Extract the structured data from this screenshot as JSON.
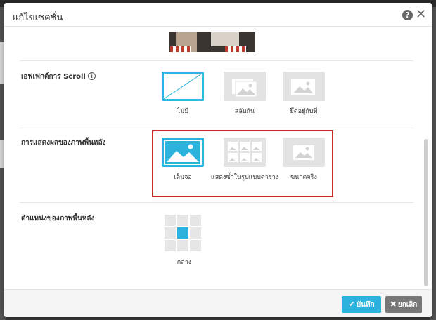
{
  "dialog": {
    "title": "แก้ไขเซคชั่น",
    "help_icon": "question-circle-icon",
    "close_icon": "close-icon"
  },
  "sections": {
    "scroll_effect": {
      "label": "เอฟเฟกต์การ Scroll",
      "info_icon": "info-icon",
      "options": [
        {
          "label": "ไม่มี",
          "selected": true
        },
        {
          "label": "สลับกัน",
          "selected": false
        },
        {
          "label": "ยึดอยู่กับที่",
          "selected": false
        }
      ]
    },
    "background_display": {
      "label": "การแสดงผลของภาพพื้นหลัง",
      "options": [
        {
          "label": "เต็มจอ",
          "selected": true
        },
        {
          "label": "แสดงซ้ำในรูปแบบตาราง",
          "selected": false
        },
        {
          "label": "ขนาดจริง",
          "selected": false
        }
      ]
    },
    "background_position": {
      "label": "ตำแหน่งของภาพพื้นหลัง",
      "selected_label": "กลาง"
    }
  },
  "footer": {
    "save_label": "บันทึก",
    "cancel_label": "ยกเลิก",
    "save_icon": "check-icon",
    "cancel_icon": "x-icon"
  },
  "colors": {
    "accent": "#2bb3de",
    "highlight_border": "#d0262e",
    "cancel_button": "#777777"
  }
}
